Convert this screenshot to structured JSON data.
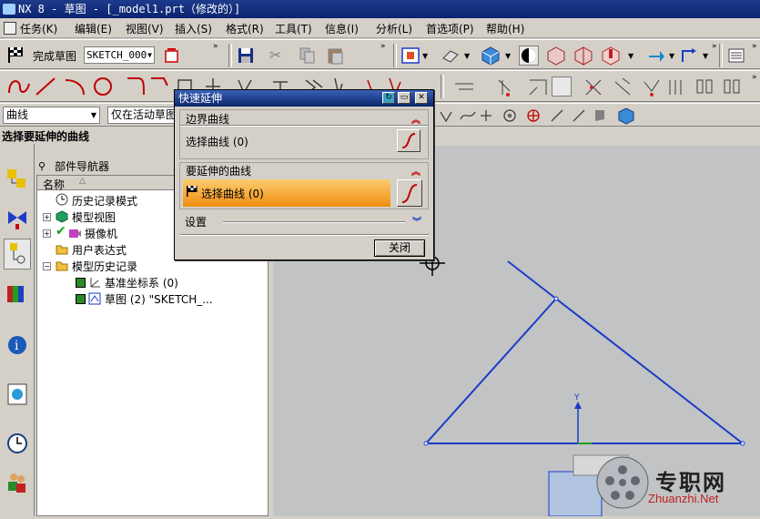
{
  "window": {
    "title": "NX 8 - 草图 - [_model1.prt（修改的）]"
  },
  "menu": [
    {
      "label": "任务(K)"
    },
    {
      "label": "编辑(E)"
    },
    {
      "label": "视图(V)"
    },
    {
      "label": "插入(S)"
    },
    {
      "label": "格式(R)"
    },
    {
      "label": "工具(T)"
    },
    {
      "label": "信息(I)"
    },
    {
      "label": "分析(L)"
    },
    {
      "label": "首选项(P)"
    },
    {
      "label": "帮助(H)"
    }
  ],
  "toolbar": {
    "finish_sketch_label": "完成草图",
    "sketch_name": "SKETCH_000"
  },
  "filter_bar": {
    "type_filter": "曲线",
    "scope_filter": "仅在活动草图"
  },
  "cue_line": "选择要延伸的曲线",
  "navigator": {
    "title": "部件导航器",
    "column_header": "名称",
    "items": [
      {
        "label": "历史记录模式"
      },
      {
        "label": "模型视图"
      },
      {
        "label": "摄像机"
      },
      {
        "label": "用户表达式"
      },
      {
        "label": "模型历史记录"
      },
      {
        "label": "基准坐标系 (0)"
      },
      {
        "label": "草图 (2) \"SKETCH_..."
      }
    ]
  },
  "dialog": {
    "title": "快速延伸",
    "boundary_group": "边界曲线",
    "boundary_select": "选择曲线 (0)",
    "extend_group": "要延伸的曲线",
    "extend_select": "选择曲线 (0)",
    "settings_group": "设置",
    "close_button": "关闭"
  },
  "watermark": {
    "site_cn": "专职网",
    "site_url": "Zhuanzhi.Net"
  },
  "colors": {
    "title_bar": "#0a246a",
    "sketch_line": "#1a3cc8",
    "active_row": "#f7a02a",
    "canvas": "#c2c3c4"
  }
}
